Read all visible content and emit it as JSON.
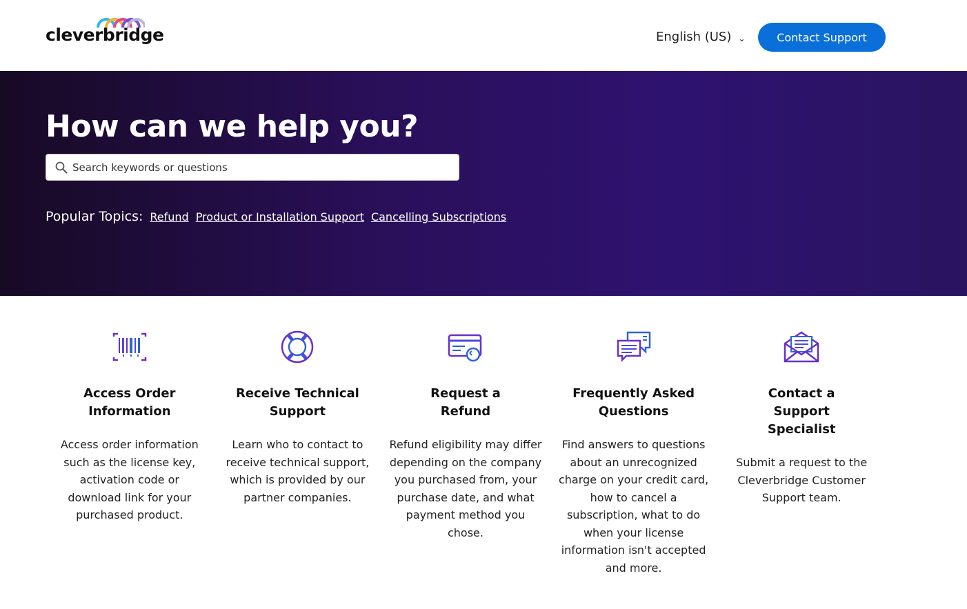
{
  "brand": {
    "name": "cleverbridge"
  },
  "header": {
    "language": "English (US)",
    "contact_button": "Contact Support"
  },
  "hero": {
    "title": "How can we help you?",
    "search_placeholder": "Search keywords or questions",
    "popular_label": "Popular Topics:",
    "popular_topics": [
      "Refund",
      "Product or Installation Support",
      "Cancelling Subscriptions"
    ]
  },
  "cards": [
    {
      "icon": "barcode-icon",
      "title": "Access Order Information",
      "description": "Access order information such as the license key, activation code or download link for your purchased product."
    },
    {
      "icon": "lifebuoy-icon",
      "title": "Receive Technical Support",
      "description": "Learn who to contact to receive technical support, which is provided by our partner companies."
    },
    {
      "icon": "credit-card-refund-icon",
      "title": "Request a Refund",
      "description": "Refund eligibility may differ depending on the company you purchased from, your purchase date, and what payment method you chose."
    },
    {
      "icon": "chat-bubbles-icon",
      "title": "Frequently Asked Questions",
      "description": "Find answers to questions about an unrecognized charge on your credit card, how to cancel a subscription, what to do when your license information isn't accepted and more."
    },
    {
      "icon": "envelope-icon",
      "title": "Contact a Support Specialist",
      "description": "Submit a request to the Cleverbridge Customer Support team."
    }
  ],
  "colors": {
    "accent": "#0a6fd9",
    "hero_dark": "#170a24",
    "hero_purple": "#2e1270",
    "icon_purple": "#6a2fc9",
    "icon_blue": "#2f63d6"
  }
}
